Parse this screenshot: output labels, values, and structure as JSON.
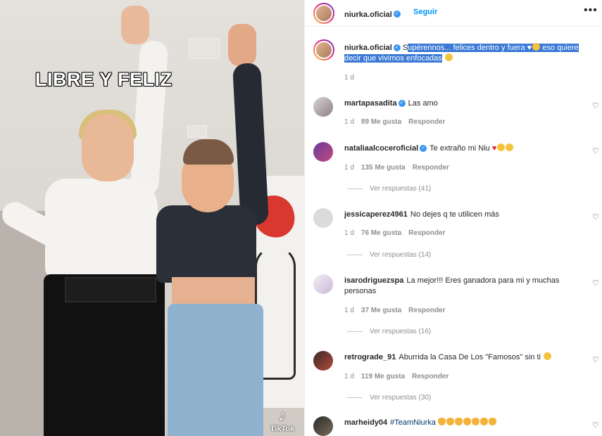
{
  "media": {
    "overlay_text": "LIBRE Y FELIZ",
    "watermark": "TikTok"
  },
  "header": {
    "username": "niurka.oficial",
    "follow_label": "Seguir",
    "more_label": "•••"
  },
  "caption": {
    "username": "niurka.oficial",
    "lead": "S",
    "selected_text_1": "upérennos... felices dentro y fuera",
    "selected_text_2": "eso quiere decir que vivimos enfocadas",
    "time": "1 d"
  },
  "comments": [
    {
      "username": "martapasadita",
      "verified": true,
      "text": "Las amo",
      "time": "1 d",
      "likes": "89 Me gusta",
      "reply": "Responder"
    },
    {
      "username": "nataliaalcoceroficial",
      "verified": true,
      "text": "Te extraño mi Niu",
      "time": "1 d",
      "likes": "135 Me gusta",
      "reply": "Responder",
      "view_replies": "Ver respuestas (41)"
    },
    {
      "username": "jessicaperez4961",
      "verified": false,
      "text": "No dejes q te utilicen más",
      "time": "1 d",
      "likes": "76 Me gusta",
      "reply": "Responder",
      "view_replies": "Ver respuestas (14)"
    },
    {
      "username": "isarodriguezspa",
      "verified": false,
      "text": "La mejor!!! Eres ganadora para mi y muchas personas",
      "time": "1 d",
      "likes": "37 Me gusta",
      "reply": "Responder",
      "view_replies": "Ver respuestas (16)"
    },
    {
      "username": "retrograde_91",
      "verified": false,
      "text": "Aburrida la Casa De Los \"Famosos\" sin ti",
      "time": "1 d",
      "likes": "119 Me gusta",
      "reply": "Responder",
      "view_replies": "Ver respuestas (30)"
    },
    {
      "username": "marheidy04",
      "verified": false,
      "text": "#TeamNiurka"
    }
  ],
  "colors": {
    "accent": "#0095f6",
    "verified": "#3897f0",
    "selection": "#3a79d6",
    "meta_text": "#8e8e8e"
  },
  "icons": [
    "verified-badge-icon",
    "heart-icon",
    "more-options-icon",
    "tiktok-icon"
  ]
}
